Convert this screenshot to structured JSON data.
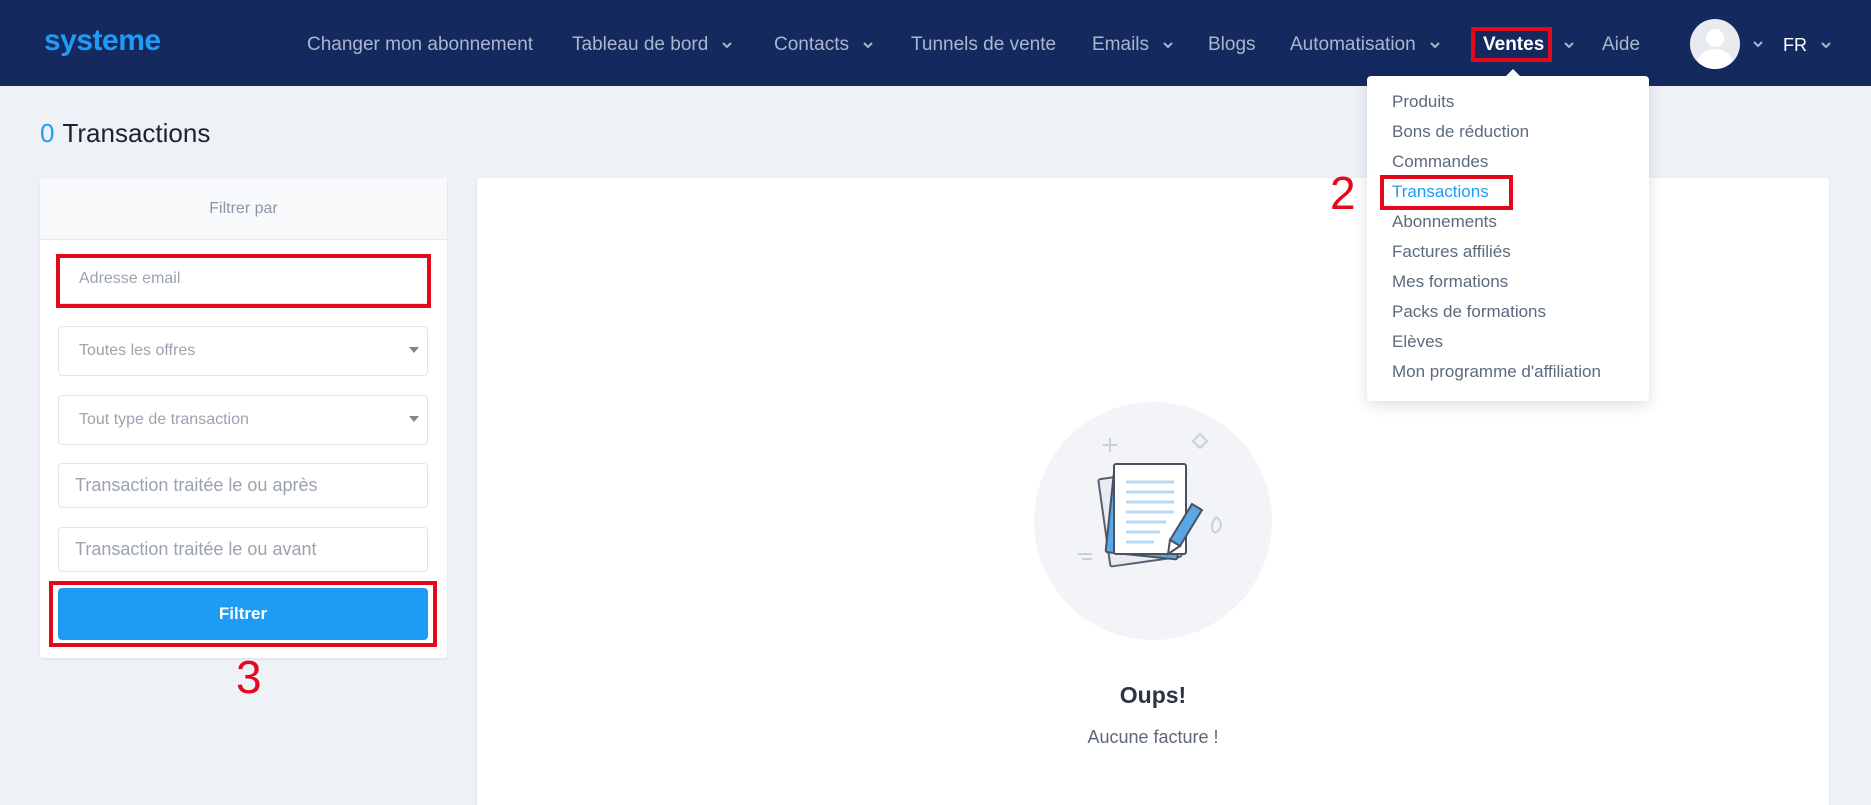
{
  "brand": {
    "logo": "systeme"
  },
  "nav": {
    "items": [
      {
        "label": "Changer mon abonnement"
      },
      {
        "label": "Tableau de bord"
      },
      {
        "label": "Contacts"
      },
      {
        "label": "Tunnels de vente"
      },
      {
        "label": "Emails"
      },
      {
        "label": "Blogs"
      },
      {
        "label": "Automatisation"
      },
      {
        "label": "Ventes"
      },
      {
        "label": "Aide"
      }
    ],
    "language": "FR"
  },
  "page": {
    "count": "0",
    "title": "Transactions"
  },
  "filters": {
    "heading": "Filtrer par",
    "email_placeholder": "Adresse email",
    "offers_placeholder": "Toutes les offres",
    "type_placeholder": "Tout type de transaction",
    "after_placeholder": "Transaction traitée le ou après",
    "before_placeholder": "Transaction traitée le ou avant",
    "submit_label": "Filtrer"
  },
  "empty_state": {
    "title": "Oups!",
    "message": "Aucune facture !"
  },
  "ventes_menu": {
    "items": [
      {
        "label": "Produits"
      },
      {
        "label": "Bons de réduction"
      },
      {
        "label": "Commandes"
      },
      {
        "label": "Transactions"
      },
      {
        "label": "Abonnements"
      },
      {
        "label": "Factures affiliés"
      },
      {
        "label": "Mes formations"
      },
      {
        "label": "Packs de formations"
      },
      {
        "label": "Elèves"
      },
      {
        "label": "Mon programme d'affiliation"
      }
    ]
  },
  "annotations": {
    "step_2": "2",
    "step_3": "3"
  },
  "colors": {
    "navbar": "#142a5e",
    "accent": "#1e9cf5",
    "highlight": "#e4081c"
  }
}
